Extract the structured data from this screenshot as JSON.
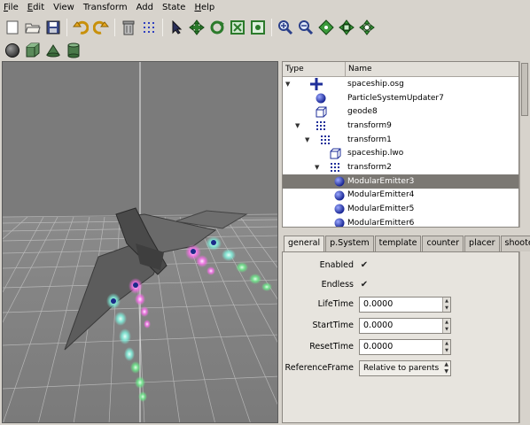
{
  "menubar": {
    "items": [
      {
        "underline": "F",
        "rest": "ile"
      },
      {
        "underline": "E",
        "rest": "dit"
      },
      {
        "underline": "",
        "rest": "View"
      },
      {
        "underline": "",
        "rest": "Transform"
      },
      {
        "underline": "",
        "rest": "Add"
      },
      {
        "underline": "",
        "rest": "State"
      },
      {
        "underline": "H",
        "rest": "elp"
      }
    ]
  },
  "toolbar_main": {
    "icons": [
      "new-icon",
      "open-icon",
      "save-icon",
      "undo-icon",
      "redo-icon",
      "delete-icon",
      "grid-icon",
      "select-arrow-icon",
      "move-icon",
      "rotate-icon",
      "scale-icon",
      "fit-icon",
      "zoom-in-icon",
      "zoom-out-icon",
      "pan-icon",
      "translate-icon",
      "orbit-icon"
    ]
  },
  "toolbar_shapes": {
    "icons": [
      "sphere-icon",
      "box-icon",
      "cone-icon",
      "cylinder-icon"
    ]
  },
  "scene_tree": {
    "columns": [
      "Type",
      "Name"
    ],
    "rows": [
      {
        "name": "spaceship.osg",
        "icon": "group-plus-icon",
        "depth": 0,
        "expanded": true,
        "selected": false
      },
      {
        "name": "ParticleSystemUpdater7",
        "icon": "blue-sphere-icon",
        "depth": 1,
        "expanded": null,
        "selected": false
      },
      {
        "name": "geode8",
        "icon": "cube-outline-icon",
        "depth": 1,
        "expanded": null,
        "selected": false
      },
      {
        "name": "transform9",
        "icon": "transform-grid-icon",
        "depth": 1,
        "expanded": true,
        "selected": false
      },
      {
        "name": "transform1",
        "icon": "transform-grid-icon",
        "depth": 2,
        "expanded": true,
        "selected": false
      },
      {
        "name": "spaceship.lwo",
        "icon": "cube-outline-icon",
        "depth": 3,
        "expanded": null,
        "selected": false
      },
      {
        "name": "transform2",
        "icon": "transform-grid-icon",
        "depth": 3,
        "expanded": true,
        "selected": false
      },
      {
        "name": "ModularEmitter3",
        "icon": "blue-sphere-icon",
        "depth": 4,
        "expanded": null,
        "selected": true
      },
      {
        "name": "ModularEmitter4",
        "icon": "blue-sphere-icon",
        "depth": 4,
        "expanded": null,
        "selected": false
      },
      {
        "name": "ModularEmitter5",
        "icon": "blue-sphere-icon",
        "depth": 4,
        "expanded": null,
        "selected": false
      },
      {
        "name": "ModularEmitter6",
        "icon": "blue-sphere-icon",
        "depth": 4,
        "expanded": null,
        "selected": false
      }
    ]
  },
  "tabs": [
    {
      "label": "general",
      "active": true
    },
    {
      "label": "p.System",
      "active": false
    },
    {
      "label": "template",
      "active": false
    },
    {
      "label": "counter",
      "active": false
    },
    {
      "label": "placer",
      "active": false
    },
    {
      "label": "shooter",
      "active": false
    }
  ],
  "properties": {
    "enabled": {
      "label": "Enabled",
      "checked": true
    },
    "endless": {
      "label": "Endless",
      "checked": true
    },
    "lifetime": {
      "label": "LifeTime",
      "value": "0.0000"
    },
    "starttime": {
      "label": "StartTime",
      "value": "0.0000"
    },
    "resettime": {
      "label": "ResetTime",
      "value": "0.0000"
    },
    "referenceframe": {
      "label": "ReferenceFrame",
      "value": "Relative to parents"
    }
  },
  "colors": {
    "selection": "#7b7873",
    "accent_blue": "#2a3fb8",
    "particle_cyan": "#7ff5e0",
    "particle_magenta": "#ff6ef0",
    "particle_green": "#6bee8a"
  }
}
